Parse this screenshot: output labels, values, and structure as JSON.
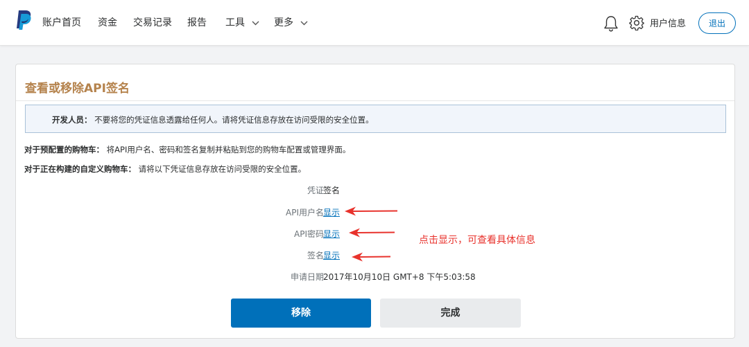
{
  "nav": {
    "items": [
      "账户首页",
      "资金",
      "交易记录",
      "报告",
      "工具",
      "更多"
    ],
    "user_info": "用户信息",
    "logout": "退出"
  },
  "card": {
    "title": "查看或移除API签名",
    "notice": {
      "label": "开发人员：",
      "text": "不要将您的凭证信息透露给任何人。请将凭证信息存放在访问受限的安全位置。"
    },
    "line1": {
      "label": "对于预配置的购物车：",
      "text": "将API用户名、密码和签名复制并粘贴到您的购物车配置或管理界面。"
    },
    "line2": {
      "label": "对于正在构建的自定义购物车：",
      "text": "请将以下凭证信息存放在访问受限的安全位置。"
    },
    "rows": [
      {
        "label": "凭证",
        "value": "签名"
      },
      {
        "label": "API用户名",
        "value": "显示"
      },
      {
        "label": "API密码",
        "value": "显示"
      },
      {
        "label": "签名",
        "value": "显示"
      },
      {
        "label": "申请日期",
        "value": "2017年10月10日 GMT+8 下午5:03:58"
      }
    ],
    "annotation": "点击显示，可查看具体信息",
    "remove_label": "移除",
    "done_label": "完成"
  },
  "colors": {
    "brand_blue": "#0070ba",
    "title_gold": "#b5834d",
    "annotation_red": "#e8322c"
  },
  "icons": [
    "paypal-logo",
    "chevron-down-icon",
    "bell-icon",
    "gear-icon",
    "red-arrow-icon"
  ]
}
